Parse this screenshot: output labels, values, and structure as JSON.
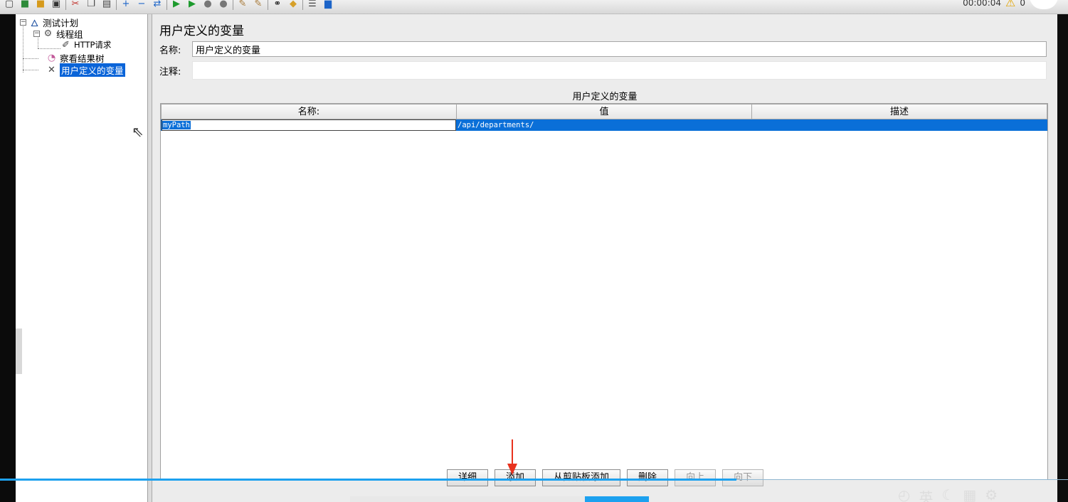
{
  "toolbar": {
    "icons": [
      "new-icon",
      "templates-icon",
      "open-icon",
      "save-icon",
      "cut-icon",
      "copy-icon",
      "paste-icon",
      "expand-icon",
      "collapse-icon",
      "toggle-icon",
      "start-icon",
      "start-no-pause-icon",
      "stop-icon",
      "shutdown-icon",
      "clear-icon",
      "clear-all-icon",
      "search-icon",
      "reset-search-icon",
      "function-helper-icon",
      "help-icon"
    ],
    "timer": "00:00:04",
    "warning_count": "0"
  },
  "tree": {
    "items": [
      {
        "label": "测试计划",
        "icon": "test-plan-icon"
      },
      {
        "label": "线程组",
        "icon": "thread-group-icon"
      },
      {
        "label": "HTTP请求",
        "icon": "http-sampler-icon"
      },
      {
        "label": "察看结果树",
        "icon": "results-tree-icon"
      },
      {
        "label": "用户定义的变量",
        "icon": "config-variables-icon"
      }
    ]
  },
  "main": {
    "title": "用户定义的变量",
    "name_label": "名称:",
    "name_value": "用户定义的变量",
    "comment_label": "注释:",
    "comment_value": "",
    "table_caption": "用户定义的变量",
    "columns": [
      "名称:",
      "值",
      "描述"
    ],
    "rows": [
      {
        "name": "myPath",
        "value": "/api/departments/",
        "description": ""
      }
    ]
  },
  "buttons": {
    "detail": "详细",
    "add": "添加",
    "add_from_clipboard": "从剪贴板添加",
    "delete": "删除",
    "up": "向上",
    "down": "向下"
  },
  "colors": {
    "selection": "#0a6fd8",
    "annotation_arrow": "#e8321e",
    "progress": "#1da1ef"
  }
}
